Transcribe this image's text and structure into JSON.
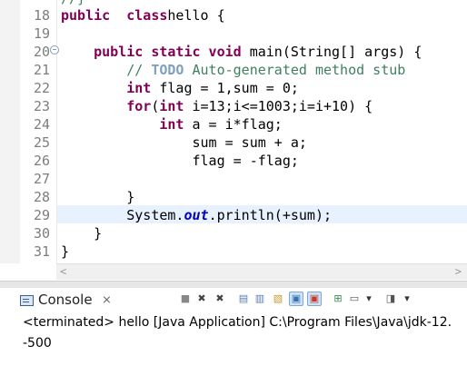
{
  "editor": {
    "partial_top_line": "//}",
    "line_numbers": [
      "18",
      "19",
      "20",
      "21",
      "22",
      "23",
      "24",
      "25",
      "26",
      "27",
      "28",
      "29",
      "30",
      "31"
    ],
    "lines": [
      {
        "parts": [
          [
            "kw",
            "public"
          ],
          [
            "",
            "  "
          ],
          [
            "kw",
            "class"
          ],
          [
            "",
            "",
            " "
          ],
          [
            "",
            "hello {"
          ]
        ]
      },
      {
        "parts": []
      },
      {
        "parts": [
          [
            "",
            "    "
          ],
          [
            "kw",
            "public static void"
          ],
          [
            "",
            " main(String[] args) {"
          ]
        ]
      },
      {
        "parts": [
          [
            "",
            "        "
          ],
          [
            "cm",
            "// "
          ],
          [
            "todo",
            "TODO"
          ],
          [
            "cm",
            " Auto-generated method stub"
          ]
        ]
      },
      {
        "parts": [
          [
            "",
            "        "
          ],
          [
            "kw",
            "int"
          ],
          [
            "",
            " flag = 1,sum = 0;"
          ]
        ]
      },
      {
        "parts": [
          [
            "",
            "        "
          ],
          [
            "kw",
            "for"
          ],
          [
            "",
            "("
          ],
          [
            "kw",
            "int"
          ],
          [
            "",
            " i=13;i<=1003;i=i+10) {"
          ]
        ]
      },
      {
        "parts": [
          [
            "",
            "            "
          ],
          [
            "kw",
            "int"
          ],
          [
            "",
            " a = i*flag;"
          ]
        ]
      },
      {
        "parts": [
          [
            "",
            "                sum = sum + a;"
          ]
        ]
      },
      {
        "parts": [
          [
            "",
            "                flag = -flag;"
          ]
        ]
      },
      {
        "parts": []
      },
      {
        "parts": [
          [
            "",
            "        }"
          ]
        ]
      },
      {
        "parts": [
          [
            "",
            "        System."
          ],
          [
            "fi",
            "out"
          ],
          [
            "",
            ".println(+sum);"
          ]
        ]
      },
      {
        "parts": [
          [
            "",
            "    }"
          ]
        ]
      },
      {
        "parts": [
          [
            "",
            "}"
          ]
        ]
      }
    ],
    "fold_marker": "−",
    "scroll_left": "<",
    "scroll_right": ">"
  },
  "console": {
    "tab_label": "Console",
    "tab_close": "⨯",
    "toolbar": [
      {
        "icon": "terminate-icon",
        "glyph": "■"
      },
      {
        "icon": "remove-launch-icon",
        "glyph": "✖"
      },
      {
        "icon": "remove-all-terminated-icon",
        "glyph": "✖"
      },
      {
        "icon": "clear-console-icon",
        "glyph": "▤"
      },
      {
        "icon": "scroll-lock-icon",
        "glyph": "▥"
      },
      {
        "icon": "word-wrap-icon",
        "glyph": "▧"
      },
      {
        "icon": "show-when-stdout-icon",
        "glyph": "▣"
      },
      {
        "icon": "show-when-stderr-icon",
        "glyph": "▣"
      },
      {
        "icon": "pin-console-icon",
        "glyph": "⊞"
      },
      {
        "icon": "display-selected-console-icon",
        "glyph": "▭"
      },
      {
        "icon": "display-dropdown-icon",
        "glyph": "▾"
      },
      {
        "icon": "open-console-icon",
        "glyph": "◨"
      },
      {
        "icon": "open-dropdown-icon",
        "glyph": "▾"
      }
    ],
    "header": "<terminated> hello [Java Application] C:\\Program Files\\Java\\jdk-12.",
    "output": "-500"
  }
}
